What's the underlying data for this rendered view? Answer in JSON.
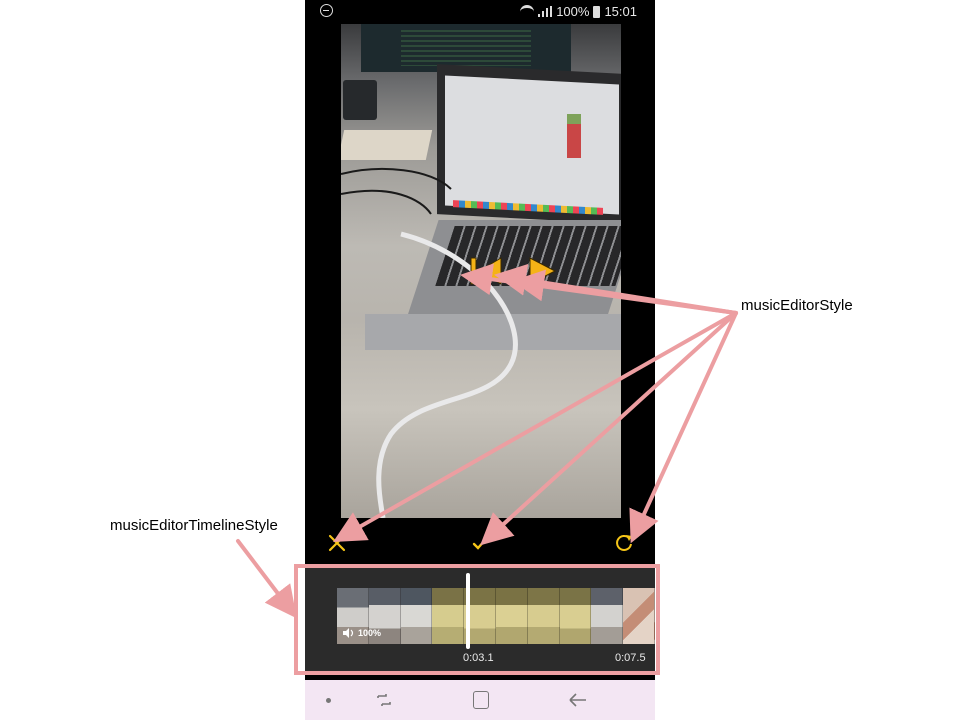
{
  "status_bar": {
    "battery": "100%",
    "time": "15:01"
  },
  "editor": {
    "prev_icon": "skip-back-icon",
    "next_icon": "play-icon",
    "cancel_icon": "close-icon",
    "confirm_icon": "check-icon",
    "reset_icon": "refresh-icon"
  },
  "timeline": {
    "volume_label": "100%",
    "current_time": "0:03.1",
    "end_time": "0:07.5",
    "playhead_progress": 0.413
  },
  "annotations": {
    "music_editor_style": "musicEditorStyle",
    "music_editor_timeline_style": "musicEditorTimelineStyle"
  },
  "colors": {
    "accent": "#f5c518",
    "annotation": "#ec9ea1",
    "nav_bg": "#f3e6f3"
  }
}
